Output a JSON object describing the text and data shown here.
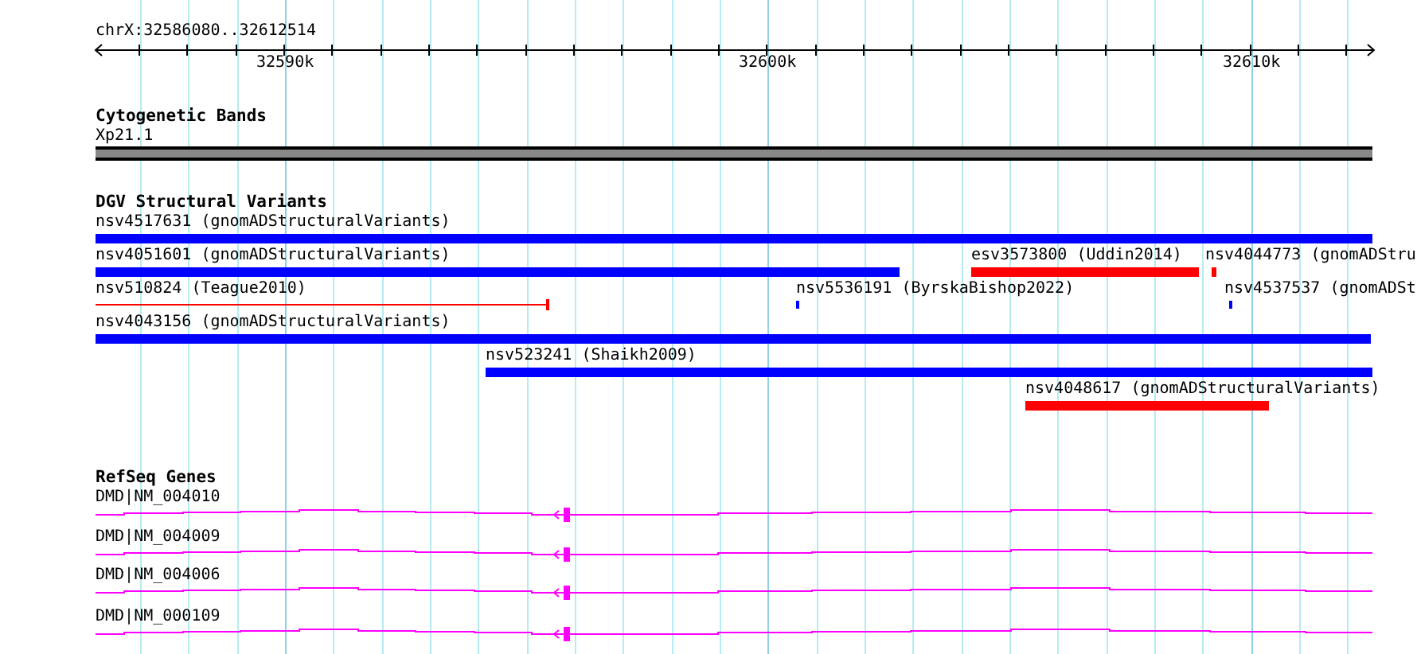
{
  "ruler": {
    "position": "chrX:32586080..32612514",
    "tick_labels": [
      "32590k",
      "32600k",
      "32610k"
    ]
  },
  "tracks": [
    {
      "kind": "bands",
      "title": "Cytogenetic Bands",
      "band_label": "Xp21.1"
    },
    {
      "kind": "variants",
      "title": "DGV Structural Variants",
      "features": [
        {
          "kind": "bar",
          "label": "nsv4517631 (gnomADStructuralVariants)",
          "color": "#0000ff"
        },
        {
          "kind": "bar",
          "label": "nsv4051601 (gnomADStructuralVariants)",
          "color": "#0000ff"
        },
        {
          "kind": "bar",
          "label": "esv3573800 (Uddin2014)",
          "color": "#ff0000"
        },
        {
          "kind": "bar",
          "label": "nsv4044773 (gnomADStru",
          "color": "#ff0000"
        },
        {
          "kind": "line",
          "label": "nsv510824 (Teague2010)",
          "color": "#ff0000"
        },
        {
          "kind": "bar",
          "label": "nsv5536191 (ByrskaBishop2022)",
          "color": "#0000ff"
        },
        {
          "kind": "bar",
          "label": "nsv4537537 (gnomADSt",
          "color": "#0000ff"
        },
        {
          "kind": "bar",
          "label": "nsv4043156 (gnomADStructuralVariants)",
          "color": "#0000ff"
        },
        {
          "kind": "bar",
          "label": "nsv523241 (Shaikh2009)",
          "color": "#0000ff"
        },
        {
          "kind": "bar",
          "label": "nsv4048617 (gnomADStructuralVariants)",
          "color": "#ff0000"
        }
      ]
    },
    {
      "kind": "genes",
      "title": "RefSeq Genes",
      "genes": [
        {
          "label": "DMD|NM_004010"
        },
        {
          "label": "DMD|NM_004009"
        },
        {
          "label": "DMD|NM_004006"
        },
        {
          "label": "DMD|NM_000109"
        }
      ]
    }
  ]
}
